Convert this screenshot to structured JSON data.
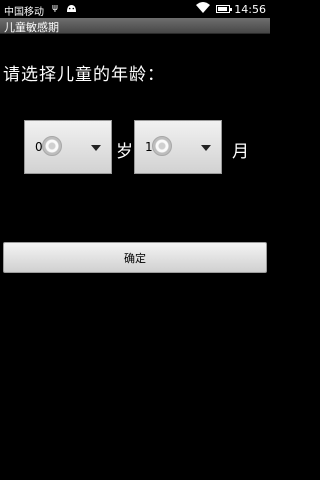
{
  "status_bar": {
    "carrier": "中国移动",
    "time": "14:56",
    "icons": [
      "usb-icon",
      "android-icon",
      "wifi-icon",
      "battery-icon"
    ]
  },
  "app": {
    "title": "儿童敏感期"
  },
  "form": {
    "prompt": "请选择儿童的年龄：",
    "years": {
      "value": "0",
      "unit": "岁"
    },
    "months": {
      "value": "1",
      "unit": "月"
    },
    "confirm_label": "确定"
  }
}
